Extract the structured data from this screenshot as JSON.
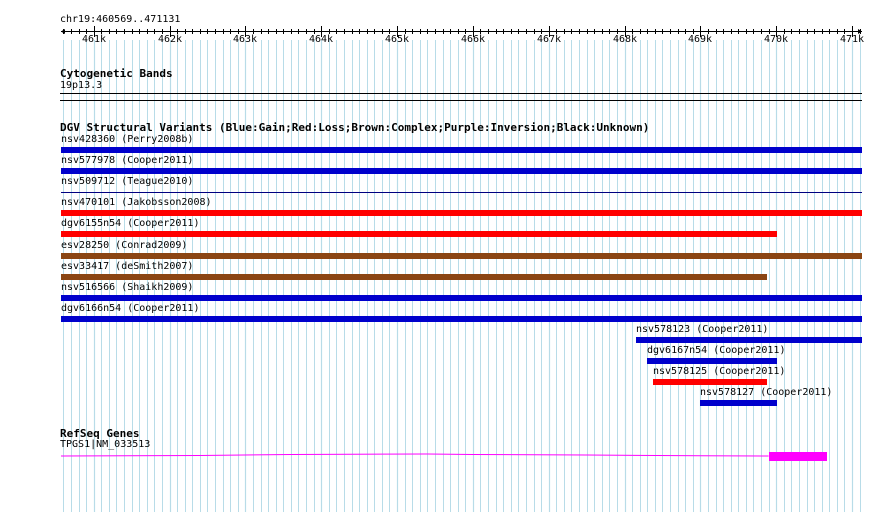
{
  "colors": {
    "grid": "#b8dce8",
    "axis": "#000000",
    "gain": "#0000cc",
    "loss": "#ff0000",
    "complex": "#8b4513",
    "gene": "#ff00ff",
    "divider": "#000080"
  },
  "axis": {
    "region": "chr19:460569..471131",
    "start": 460569,
    "end": 471131,
    "ticks": [
      {
        "pos": 461000,
        "label": "461k"
      },
      {
        "pos": 462000,
        "label": "462k"
      },
      {
        "pos": 463000,
        "label": "463k"
      },
      {
        "pos": 464000,
        "label": "464k"
      },
      {
        "pos": 465000,
        "label": "465k"
      },
      {
        "pos": 466000,
        "label": "466k"
      },
      {
        "pos": 467000,
        "label": "467k"
      },
      {
        "pos": 468000,
        "label": "468k"
      },
      {
        "pos": 469000,
        "label": "469k"
      },
      {
        "pos": 470000,
        "label": "470k"
      },
      {
        "pos": 471000,
        "label": "471k"
      }
    ]
  },
  "tracks": {
    "cytobands": {
      "title": "Cytogenetic Bands",
      "band": "19p13.3"
    },
    "dgv": {
      "title": "DGV Structural Variants (Blue:Gain;Red:Loss;Brown:Complex;Purple:Inversion;Black:Unknown)",
      "variants": [
        {
          "label": "nsv428360 (Perry2008b)",
          "type": "gain",
          "start": 460569,
          "end": 471131
        },
        {
          "label": "nsv577978 (Cooper2011)",
          "type": "gain",
          "start": 460569,
          "end": 471131
        },
        {
          "label": "nsv509712 (Teague2010)",
          "type": "gain-thin",
          "start": 460569,
          "end": 471131
        },
        {
          "label": "nsv470101 (Jakobsson2008)",
          "type": "loss",
          "start": 460569,
          "end": 471131
        },
        {
          "label": "dgv6155n54 (Cooper2011)",
          "type": "loss",
          "start": 460569,
          "end": 470010
        },
        {
          "label": "esv28250 (Conrad2009)",
          "type": "complex",
          "start": 460569,
          "end": 471131
        },
        {
          "label": "esv33417 (deSmith2007)",
          "type": "complex",
          "start": 460569,
          "end": 469880
        },
        {
          "label": "nsv516566 (Shaikh2009)",
          "type": "gain",
          "start": 460569,
          "end": 471131
        },
        {
          "label": "dgv6166n54 (Cooper2011)",
          "type": "gain",
          "start": 460569,
          "end": 471131
        },
        {
          "label": "nsv578123 (Cooper2011)",
          "type": "gain",
          "start": 468150,
          "end": 471131
        },
        {
          "label": "dgv6167n54 (Cooper2011)",
          "type": "gain",
          "start": 468290,
          "end": 470010
        },
        {
          "label": "nsv578125 (Cooper2011)",
          "type": "loss",
          "start": 468380,
          "end": 469880
        },
        {
          "label": "nsv578127 (Cooper2011)",
          "type": "gain",
          "start": 469000,
          "end": 470010
        }
      ]
    },
    "refseq": {
      "title": "RefSeq Genes",
      "gene_label": "TPGS1|NM_033513",
      "start": 460569,
      "end": 470670,
      "exon_start": 469900,
      "exon_end": 470670
    }
  }
}
